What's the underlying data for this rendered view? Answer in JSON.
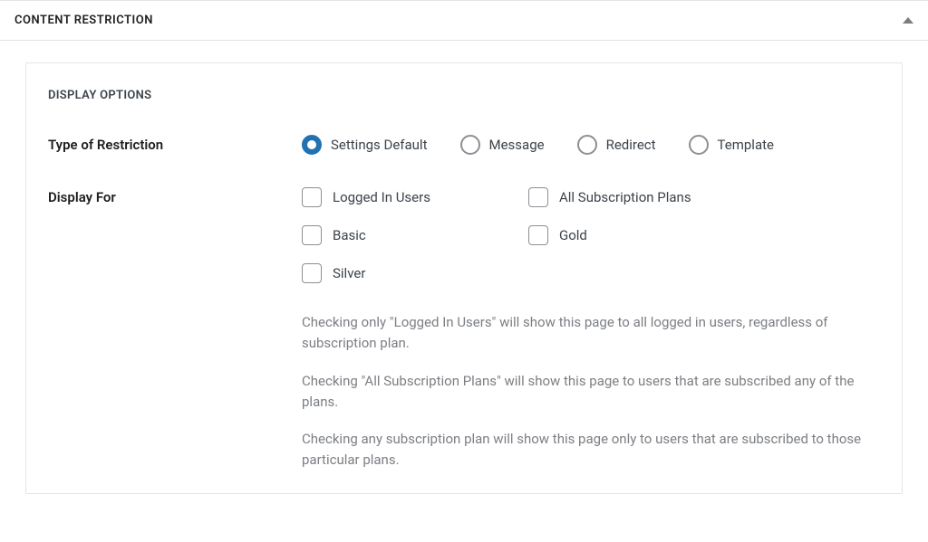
{
  "panel": {
    "title": "CONTENT RESTRICTION"
  },
  "section": {
    "title": "DISPLAY OPTIONS"
  },
  "restriction_type": {
    "label": "Type of Restriction",
    "options": [
      {
        "label": "Settings Default",
        "selected": true
      },
      {
        "label": "Message",
        "selected": false
      },
      {
        "label": "Redirect",
        "selected": false
      },
      {
        "label": "Template",
        "selected": false
      }
    ]
  },
  "display_for": {
    "label": "Display For",
    "checkboxes": [
      {
        "label": "Logged In Users"
      },
      {
        "label": "All Subscription Plans"
      },
      {
        "label": "Basic"
      },
      {
        "label": "Gold"
      },
      {
        "label": "Silver"
      }
    ],
    "help": [
      "Checking only \"Logged In Users\" will show this page to all logged in users, regardless of subscription plan.",
      "Checking \"All Subscription Plans\" will show this page to users that are subscribed any of the plans.",
      "Checking any subscription plan will show this page only to users that are subscribed to those particular plans."
    ]
  }
}
